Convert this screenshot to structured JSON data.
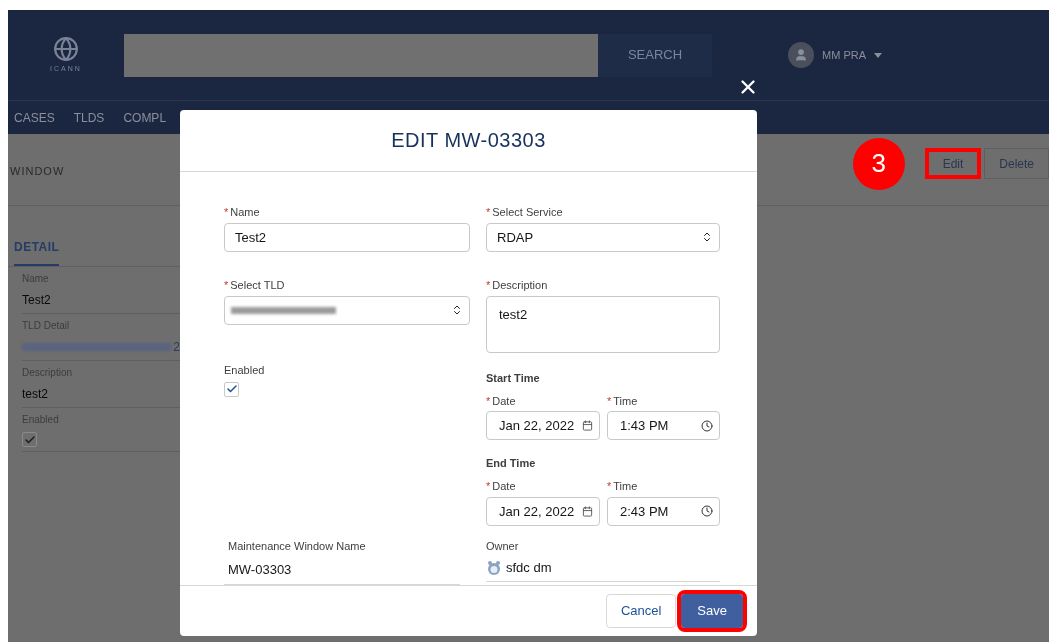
{
  "header": {
    "logo_text": "ICANN",
    "search_button": "SEARCH",
    "user_name": "MM PRA"
  },
  "nav": [
    "CASES",
    "TLDS",
    "COMPL"
  ],
  "record": {
    "title": "WINDOW",
    "tab": {
      "label": "DETAIL",
      "selected": true
    },
    "fields": [
      {
        "kind": "text",
        "label": "Name",
        "value": "Test2"
      },
      {
        "kind": "redacted",
        "label": "TLD Detail",
        "value": "2"
      },
      {
        "kind": "text",
        "label": "Description",
        "value": "test2"
      },
      {
        "kind": "checkbox",
        "label": "Enabled",
        "checked": true
      }
    ]
  },
  "step_badge": "3",
  "actions": [
    {
      "label": "Edit",
      "highlighted": true
    },
    {
      "label": "Delete",
      "highlighted": false
    }
  ],
  "modal": {
    "title": "EDIT MW-03303",
    "required_mark": "*",
    "name": {
      "label": "Name",
      "required": true,
      "value": "Test2"
    },
    "tld": {
      "label": "Select TLD",
      "required": true
    },
    "enabled": {
      "label": "Enabled",
      "checked": true
    },
    "service": {
      "label": "Select Service",
      "required": true,
      "value": "RDAP"
    },
    "description": {
      "label": "Description",
      "required": true,
      "value": "test2"
    },
    "times": [
      {
        "heading": "Start Time",
        "date_label": "Date",
        "date_required": true,
        "date": "Jan 22, 2022",
        "time_label": "Time",
        "time_required": true,
        "time": "1:43 PM"
      },
      {
        "heading": "End Time",
        "date_label": "Date",
        "date_required": true,
        "date": "Jan 22, 2022",
        "time_label": "Time",
        "time_required": true,
        "time": "2:43 PM"
      }
    ],
    "mw_name": {
      "label": "Maintenance Window Name",
      "value": "MW-03303"
    },
    "owner": {
      "label": "Owner",
      "value": "sfdc dm"
    },
    "buttons": [
      {
        "label": "Cancel",
        "kind": "neutral",
        "highlighted": false
      },
      {
        "label": "Save",
        "kind": "brand",
        "highlighted": true
      }
    ]
  }
}
